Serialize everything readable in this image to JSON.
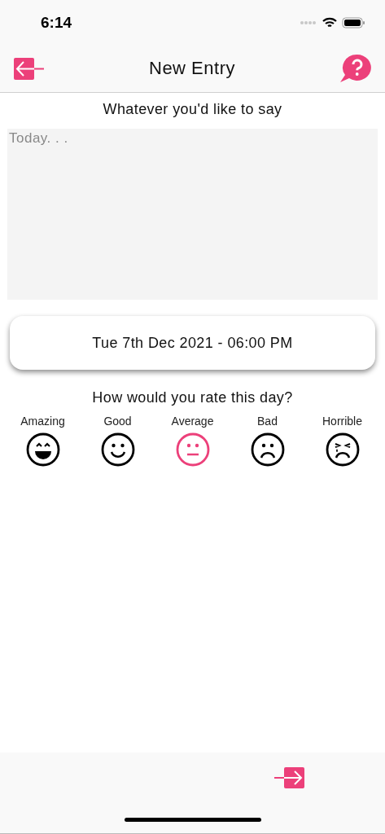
{
  "status_bar": {
    "time": "6:14"
  },
  "nav": {
    "title": "New Entry"
  },
  "entry": {
    "prompt": "Whatever you'd like to say",
    "placeholder": "Today. . ."
  },
  "date_button": {
    "label": "Tue 7th Dec 2021 - 06:00 PM"
  },
  "rating": {
    "question": "How would you rate this day?",
    "moods": [
      {
        "label": "Amazing",
        "kind": "amazing",
        "selected": false
      },
      {
        "label": "Good",
        "kind": "good",
        "selected": false
      },
      {
        "label": "Average",
        "kind": "average",
        "selected": true
      },
      {
        "label": "Bad",
        "kind": "bad",
        "selected": false
      },
      {
        "label": "Horrible",
        "kind": "horrible",
        "selected": false
      }
    ]
  }
}
